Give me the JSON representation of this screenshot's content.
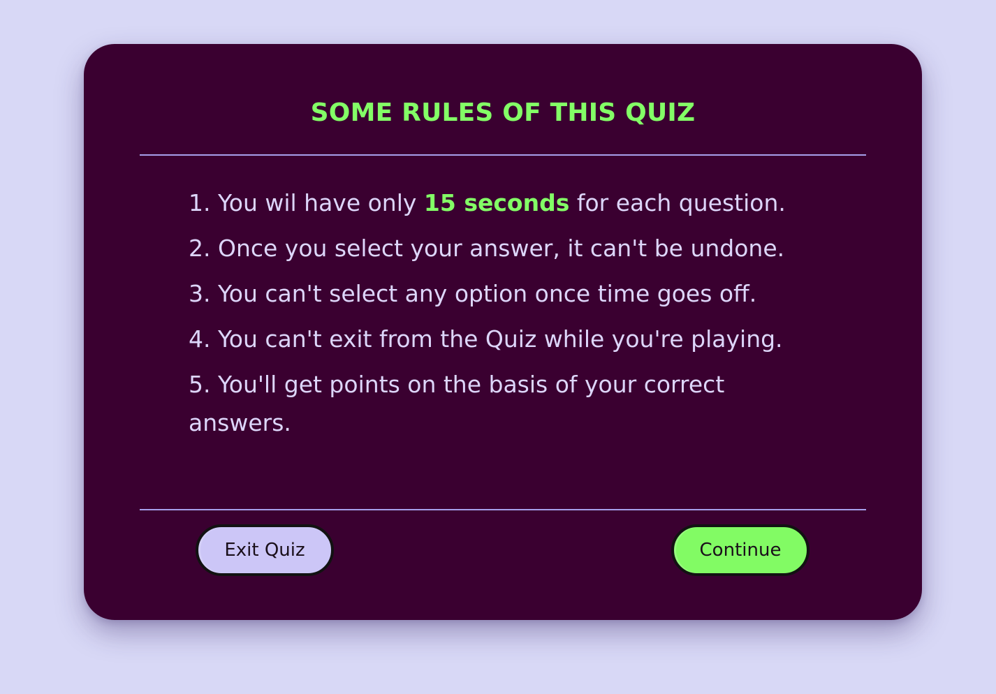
{
  "modal": {
    "title": "SOME RULES OF THIS QUIZ",
    "rules": {
      "r1_pre": "1. You wil have only ",
      "r1_highlight": "15 seconds",
      "r1_post": " for each question.",
      "r2": "2. Once you select your answer, it can't be undone.",
      "r3": "3. You can't select any option once time goes off.",
      "r4": "4. You can't exit from the Quiz while you're playing.",
      "r5": "5. You'll get points on the basis of your correct answers."
    },
    "buttons": {
      "exit_label": "Exit Quiz",
      "continue_label": "Continue"
    }
  },
  "colors": {
    "page_background": "#d8d8f6",
    "card_background": "#3a0030",
    "accent_green": "#83ff66",
    "text_lavender": "#ddd6fb",
    "divider": "#a7a0ec",
    "exit_button": "#ccc6f7",
    "continue_button": "#82fb64"
  }
}
